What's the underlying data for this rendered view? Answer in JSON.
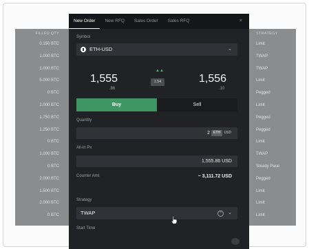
{
  "left_table": {
    "header": "FILLED QTY",
    "rows": [
      "0.150 BTC",
      "1.000 BTC",
      "1.000 BTC",
      "5.000 BTC",
      "0 BTC",
      "2.000 BTC",
      "1.750 BTC",
      "1.250 BTC",
      "0 BTC",
      "1.000 BTC",
      "0 BTC",
      "2.000 BTC",
      "1.500 BTC",
      "2.000 BTC",
      "0 BTC"
    ]
  },
  "right_table": {
    "header": "STRATEGY",
    "rows": [
      "Limit",
      "TWAP",
      "TWAP",
      "Limit",
      "Pegged",
      "Limit",
      "Pegged",
      "Pegged",
      "Limit",
      "TWAP",
      "Steady Pace",
      "Pegged",
      "Limit",
      "Limit",
      "Limit"
    ]
  },
  "tabs": [
    {
      "label": "New Order",
      "active": true
    },
    {
      "label": "New RFQ",
      "active": false
    },
    {
      "label": "Sales Order",
      "active": false
    },
    {
      "label": "Sales RFQ",
      "active": false
    }
  ],
  "close_label": "×",
  "symbol": {
    "label": "Symbol",
    "value": "ETH-USD"
  },
  "quote": {
    "bid_main": "1,555",
    "bid_sub": ".86",
    "ask_main": "1,556",
    "ask_sub": ".10",
    "spread": "1.54"
  },
  "side": {
    "buy_label": "Buy",
    "sell_label": "Sell"
  },
  "quantity": {
    "label": "Quantity",
    "value": "2",
    "ccy_selected": "ETH",
    "ccy_other": "USD"
  },
  "all_in_px": {
    "label": "All-In Px",
    "value": "1,555.86  USD"
  },
  "counter_amt": {
    "label": "Counter Amt",
    "value": "~ 3,111.72  USD"
  },
  "strategy": {
    "label": "Strategy",
    "value": "TWAP"
  },
  "start_time": {
    "label": "Start Time"
  },
  "colors": {
    "buy": "#3f9663",
    "panel": "#202226",
    "spread_up": "#3fbf7f"
  }
}
